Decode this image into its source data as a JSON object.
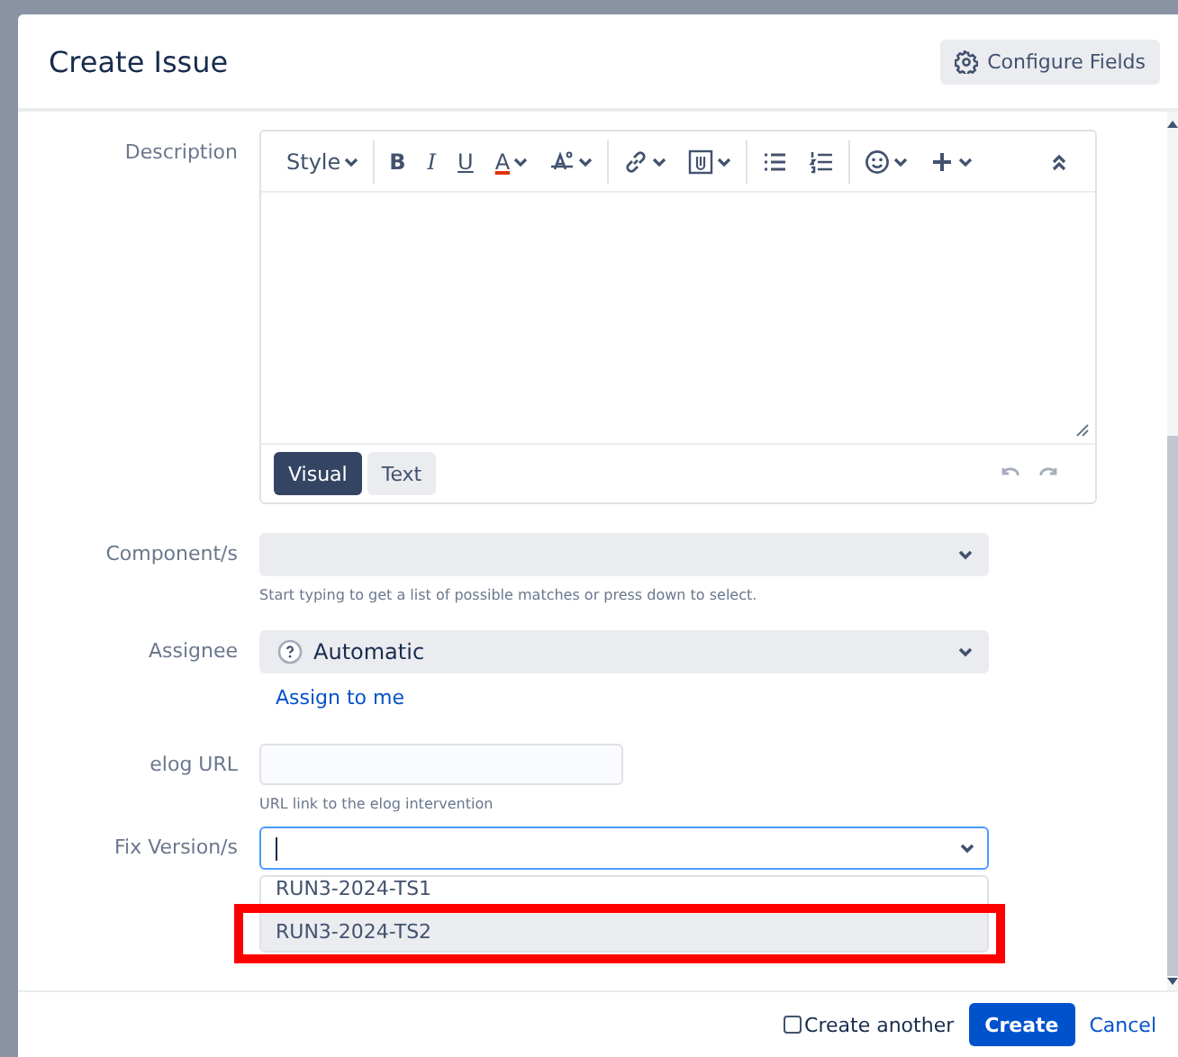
{
  "dialog": {
    "title": "Create Issue",
    "configure_button": "Configure Fields"
  },
  "description": {
    "label": "Description",
    "toolbar": [
      {
        "kind": "style",
        "label": "Style"
      },
      {
        "kind": "bold",
        "label": "B"
      },
      {
        "kind": "italic",
        "label": "I"
      },
      {
        "kind": "underline",
        "label": "U"
      },
      {
        "kind": "color",
        "label": "A"
      },
      {
        "kind": "format"
      },
      {
        "kind": "link"
      },
      {
        "kind": "attach"
      },
      {
        "kind": "bullets"
      },
      {
        "kind": "numbers"
      },
      {
        "kind": "emoji"
      },
      {
        "kind": "insert"
      },
      {
        "kind": "collapse"
      }
    ],
    "modes": [
      {
        "label": "Visual",
        "selected": true
      },
      {
        "label": "Text",
        "selected": false
      }
    ]
  },
  "fields": [
    {
      "kind": "select",
      "label": "Component/s",
      "hint": "Start typing to get a list of possible matches or press down to select."
    },
    {
      "kind": "assignee",
      "label": "Assignee",
      "value": "Automatic",
      "link": "Assign to me"
    },
    {
      "kind": "text",
      "label": "elog URL",
      "hint": "URL link to the elog intervention"
    },
    {
      "kind": "combo",
      "label": "Fix Version/s",
      "focused": true,
      "options": [
        {
          "label": "RUN3-2024-TS1",
          "selected": false
        },
        {
          "label": "RUN3-2024-TS2",
          "selected": true
        }
      ]
    }
  ],
  "footer": {
    "create_another": {
      "label": "Create another",
      "checked": false
    },
    "create_button": "Create",
    "cancel_link": "Cancel"
  }
}
